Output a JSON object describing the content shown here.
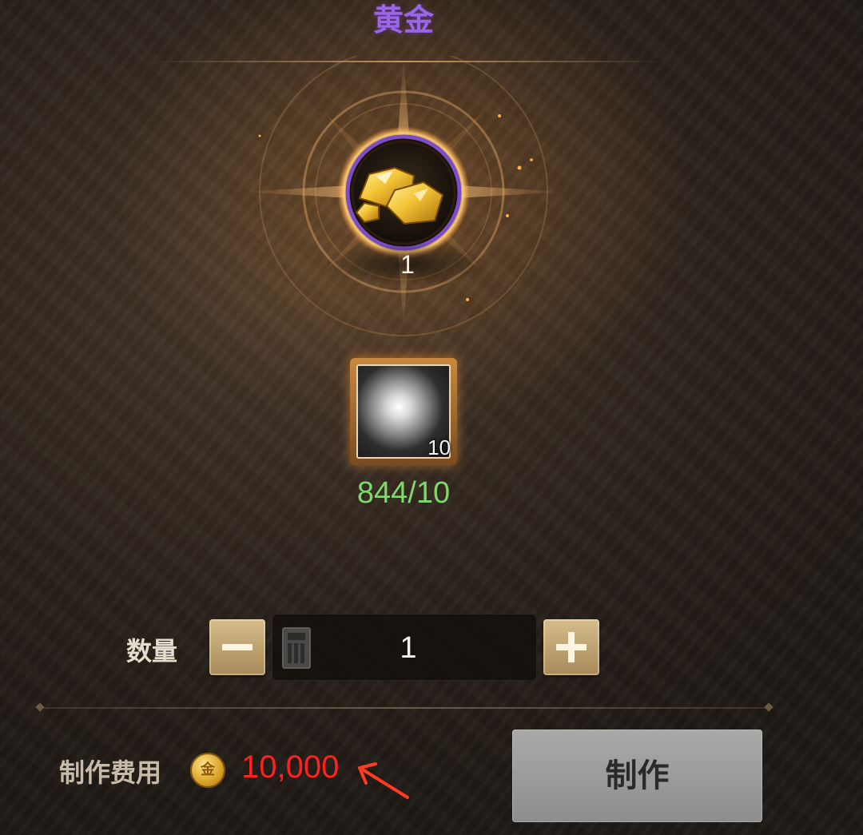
{
  "craft": {
    "item_name": "黄金",
    "output_quantity": "1"
  },
  "material": {
    "required_count": "10",
    "owned_progress": "844/10"
  },
  "quantity": {
    "label": "数量",
    "value": "1"
  },
  "cost": {
    "label": "制作费用",
    "coin_glyph": "金",
    "value": "10,000"
  },
  "actions": {
    "make_label": "制作"
  },
  "colors": {
    "item_name": "#9a66e8",
    "progress": "#7fd86a",
    "cost_value": "#ff2020",
    "annotation_arrow": "#ff3b1f"
  },
  "icons": {
    "product": "gold-nugget-icon",
    "material": "silver-orb-icon",
    "quantity_field": "calculator-icon",
    "currency": "gold-coin-icon"
  }
}
